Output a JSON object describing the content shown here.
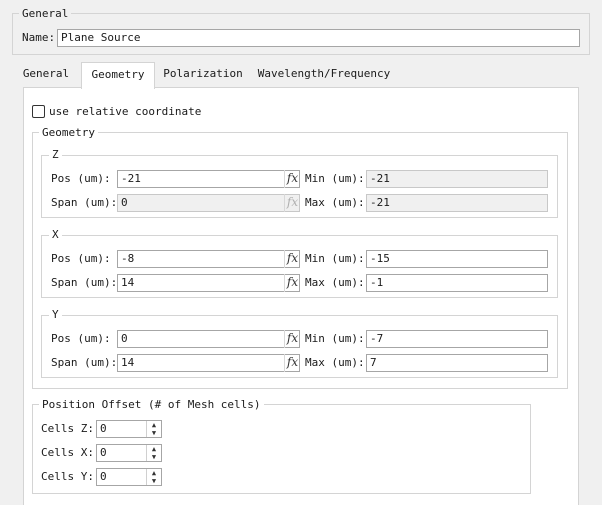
{
  "general_group": {
    "title": "General",
    "name_label": "Name:",
    "name_value": "Plane Source"
  },
  "tabs": [
    {
      "label": "General",
      "active": false
    },
    {
      "label": "Geometry",
      "active": true
    },
    {
      "label": "Polarization",
      "active": false
    },
    {
      "label": "Wavelength/Frequency",
      "active": false
    }
  ],
  "relative_coord": {
    "label": "use relative coordinate",
    "checked": false
  },
  "geometry": {
    "title": "Geometry",
    "fx_icon": "fx",
    "z": {
      "title": "Z",
      "pos_label": "Pos (um):",
      "pos_value": "-21",
      "span_label": "Span (um):",
      "span_value": "0",
      "min_label": "Min (um):",
      "min_value": "-21",
      "max_label": "Max (um):",
      "max_value": "-21"
    },
    "x": {
      "title": "X",
      "pos_label": "Pos (um):",
      "pos_value": "-8",
      "span_label": "Span (um):",
      "span_value": "14",
      "min_label": "Min (um):",
      "min_value": "-15",
      "max_label": "Max (um):",
      "max_value": "-1"
    },
    "y": {
      "title": "Y",
      "pos_label": "Pos (um):",
      "pos_value": "0",
      "span_label": "Span (um):",
      "span_value": "14",
      "min_label": "Min (um):",
      "min_value": "-7",
      "max_label": "Max (um):",
      "max_value": "7"
    }
  },
  "position_offset": {
    "title": "Position Offset (# of Mesh cells)",
    "cells_z_label": "Cells Z:",
    "cells_z_value": "0",
    "cells_x_label": "Cells X:",
    "cells_x_value": "0",
    "cells_y_label": "Cells Y:",
    "cells_y_value": "0"
  }
}
